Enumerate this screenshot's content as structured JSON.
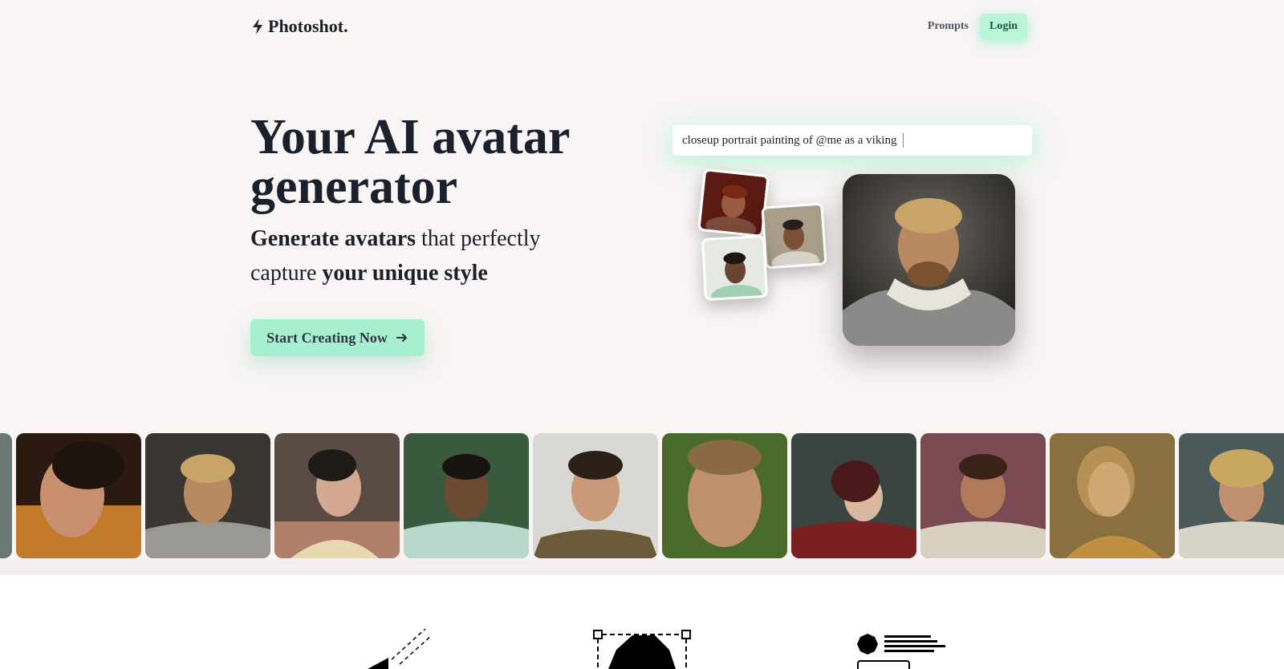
{
  "header": {
    "brand": "Photoshot.",
    "nav": {
      "prompts": "Prompts",
      "login": "Login"
    }
  },
  "hero": {
    "title": "Your AI avatar generator",
    "subtitle": {
      "part1_bold": "Generate avatars",
      "part2": " that perfectly capture ",
      "part3_bold": "your unique style"
    },
    "cta_label": "Start Creating Now"
  },
  "demo": {
    "prompt_value": "closeup portrait painting of @me as a viking"
  },
  "gallery": {
    "tile_count": 10
  },
  "features": {
    "icons": [
      "wand-icon",
      "shape-select-icon",
      "list-layout-icon"
    ]
  },
  "colors": {
    "accent": "#a6f0cf",
    "page_background": "#f8f5f4",
    "text": "#1a202c"
  }
}
